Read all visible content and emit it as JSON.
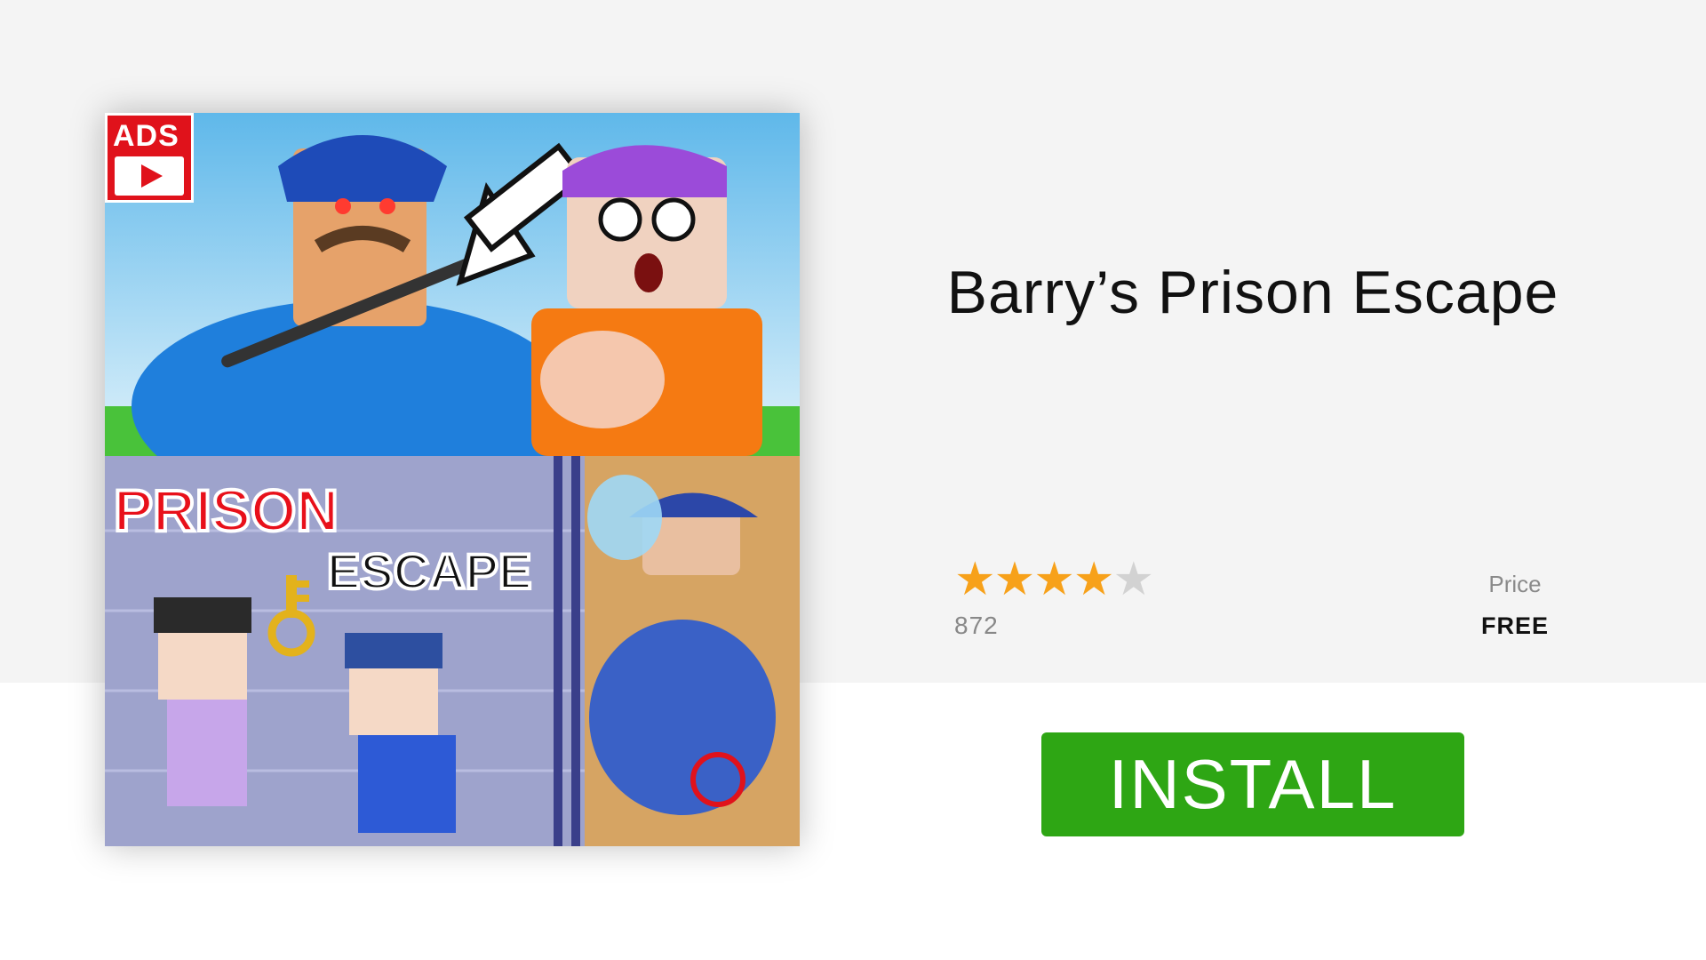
{
  "ad": {
    "badge_label": "ADS",
    "thumbnail_text": {
      "word1": "PRISON",
      "word2": "ESCAPE"
    }
  },
  "app": {
    "title": "Barry’s Prison Escape",
    "rating": 4,
    "rating_max": 5,
    "rating_count": "872",
    "price_label": "Price",
    "price_value": "FREE",
    "install_label": "INSTALL"
  },
  "colors": {
    "star": "#f7a11a",
    "star_empty": "#d2d2d2",
    "install": "#2ea614",
    "badge": "#e0121b",
    "band": "#f4f4f4"
  },
  "icons": [
    "play-icon",
    "star-icon",
    "key-icon",
    "arrow-icon"
  ]
}
